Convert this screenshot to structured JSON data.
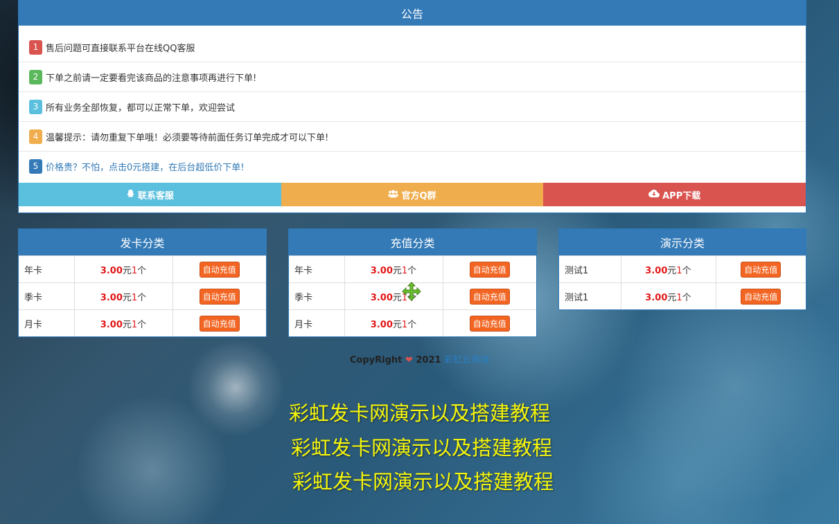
{
  "notice": {
    "title": "公告",
    "items": [
      {
        "num": "1",
        "text": "售后问题可直接联系平台在线QQ客服"
      },
      {
        "num": "2",
        "text": "下单之前请一定要看完该商品的注意事项再进行下单!"
      },
      {
        "num": "3",
        "text": "所有业务全部恢复，都可以正常下单，欢迎尝试"
      },
      {
        "num": "4",
        "text": "温馨提示：请勿重复下单哦！必须要等待前面任务订单完成才可以下单!"
      },
      {
        "num": "5",
        "text": "价格贵？不怕，点击0元搭建，在后台超低价下单!"
      }
    ],
    "buttons": {
      "contact": "联系客服",
      "group": "官方Q群",
      "app": "APP下载"
    }
  },
  "panels": [
    {
      "title": "发卡分类",
      "rows": [
        {
          "name": "年卡",
          "price": "3.00",
          "unit": "元",
          "qty": "1",
          "qty_unit": "个",
          "button": "自动充值"
        },
        {
          "name": "季卡",
          "price": "3.00",
          "unit": "元",
          "qty": "1",
          "qty_unit": "个",
          "button": "自动充值"
        },
        {
          "name": "月卡",
          "price": "3.00",
          "unit": "元",
          "qty": "1",
          "qty_unit": "个",
          "button": "自动充值"
        }
      ]
    },
    {
      "title": "充值分类",
      "rows": [
        {
          "name": "年卡",
          "price": "3.00",
          "unit": "元",
          "qty": "1",
          "qty_unit": "个",
          "button": "自动充值"
        },
        {
          "name": "季卡",
          "price": "3.00",
          "unit": "元",
          "qty": "1",
          "qty_unit": "个",
          "button": "自动充值"
        },
        {
          "name": "月卡",
          "price": "3.00",
          "unit": "元",
          "qty": "1",
          "qty_unit": "个",
          "button": "自动充值"
        }
      ]
    },
    {
      "title": "演示分类",
      "rows": [
        {
          "name": "测试1",
          "price": "3.00",
          "unit": "元",
          "qty": "1",
          "qty_unit": "个",
          "button": "自动充值"
        },
        {
          "name": "测试1",
          "price": "3.00",
          "unit": "元",
          "qty": "1",
          "qty_unit": "个",
          "button": "自动充值"
        }
      ]
    }
  ],
  "footer": {
    "prefix": "CopyRight",
    "year": "2021",
    "site": "彩虹云商城"
  },
  "captions": [
    "彩虹发卡网演示以及搭建教程",
    "彩虹发卡网演示以及搭建教程",
    "彩虹发卡网演示以及搭建教程"
  ],
  "icons": {
    "contact": "qq-icon",
    "group": "group-icon",
    "app": "cloud-download-icon",
    "heart": "heart-icon",
    "cursor": "move-cursor-icon"
  },
  "colors": {
    "primary": "#337ab7",
    "danger": "#d9534f",
    "success": "#5cb85c",
    "info": "#5bc0de",
    "warning": "#f0ad4e",
    "price": "#e21717",
    "caption": "#f5f50c"
  }
}
